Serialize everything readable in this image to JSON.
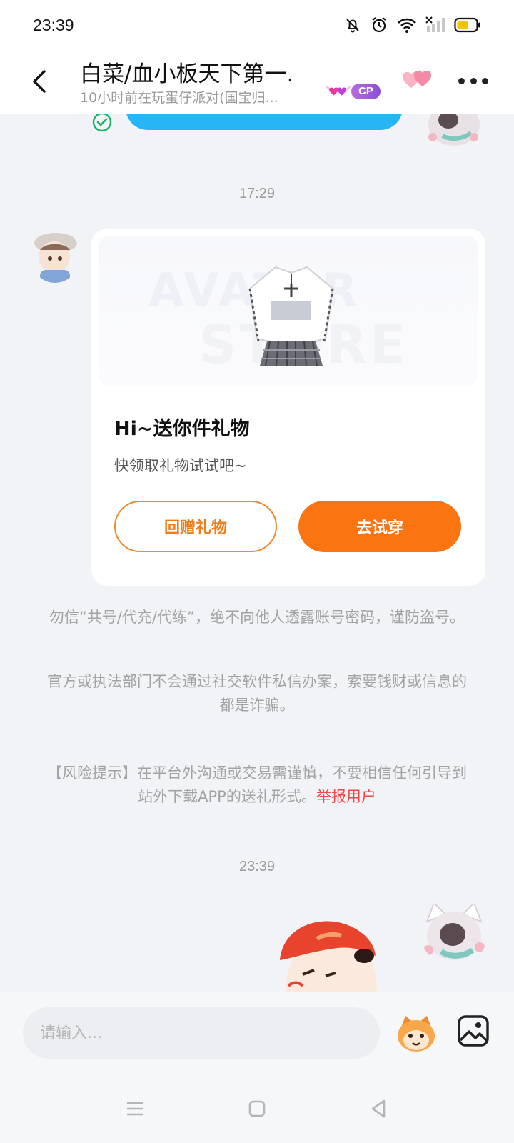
{
  "status_bar": {
    "time": "23:39",
    "icons": [
      "bell-off-icon",
      "alarm-icon",
      "wifi-icon",
      "signal-off-icon",
      "battery-icon"
    ],
    "battery_color": "#f5c400"
  },
  "header": {
    "title": "白菜/血小板天下第一.",
    "subtitle": "10小时前在玩蛋仔派对(国宝归...",
    "cp_badge": "CP",
    "icons": [
      "back-icon",
      "hearts-icon",
      "more-icon"
    ]
  },
  "chat": {
    "timestamp_1": "17:29",
    "gift_card": {
      "title": "Hi~送你件礼物",
      "subtitle": "快领取礼物试试吧~",
      "watermark_line1": "AVATAR",
      "watermark_line2": "STORE",
      "return_gift_label": "回赠礼物",
      "try_on_label": "去试穿"
    },
    "notices": {
      "notice_1": "勿信“共号/代充/代练”，绝不向他人透露账号密码，谨防盗号。",
      "notice_2": "官方或执法部门不会通过社交软件私信办案，索要钱财或信息的都是诈骗。",
      "notice_3": "【风险提示】在平台外沟通或交易需谨慎，不要相信任何引导到站外下载APP的送礼形式。",
      "report_link": "举报用户"
    },
    "timestamp_2": "23:39"
  },
  "input_bar": {
    "placeholder": "请输入...",
    "icons": [
      "emoji-sticker-icon",
      "image-icon"
    ]
  },
  "navbar": {
    "icons": [
      "menu-icon",
      "home-icon",
      "back-triangle-icon"
    ]
  },
  "colors": {
    "accent_orange": "#fa7412",
    "bubble_blue": "#27b5f5",
    "report_red": "#f04848",
    "cp_purple": "#a35ddb"
  }
}
